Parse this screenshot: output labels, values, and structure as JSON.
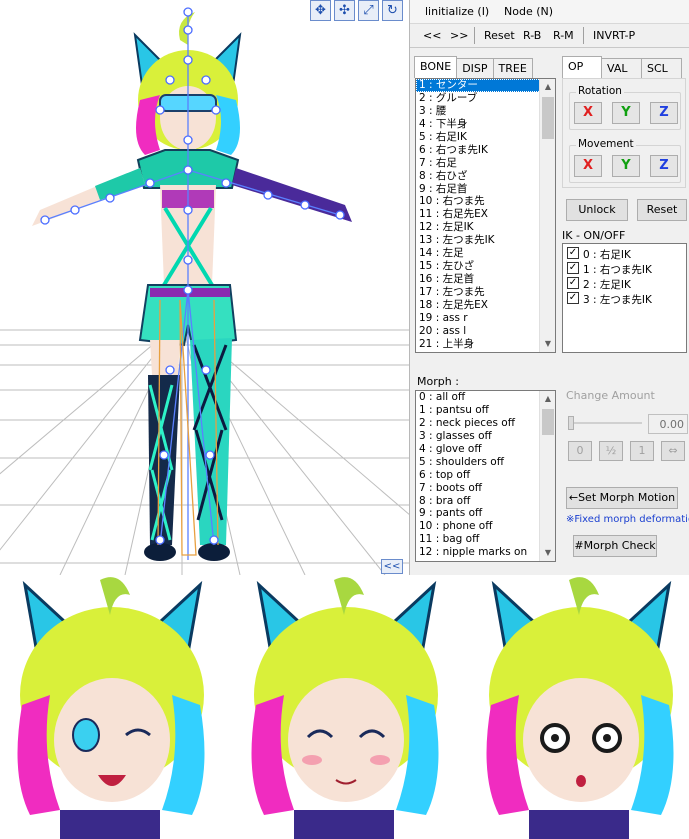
{
  "menu": {
    "initialize": "linitialize (I)",
    "node": "Node (N)"
  },
  "toolbar": {
    "prev": "<<",
    "next": ">>",
    "reset": "Reset",
    "rb": "R-B",
    "rm": "R-M",
    "invrt": "INVRT-P"
  },
  "bone_tabs": [
    "BONE",
    "DISP",
    "TREE"
  ],
  "op_tabs": [
    "OP",
    "VAL",
    "SCL"
  ],
  "bones": [
    "1 : センター",
    "2 : グルーブ",
    "3 : 腰",
    "4 : 下半身",
    "5 : 右足IK",
    "6 : 右つま先IK",
    "7 : 右足",
    "8 : 右ひざ",
    "9 : 右足首",
    "10 : 右つま先",
    "11 : 右足先EX",
    "12 : 左足IK",
    "13 : 左つま先IK",
    "14 : 左足",
    "15 : 左ひざ",
    "16 : 左足首",
    "17 : 左つま先",
    "18 : 左足先EX",
    "19 : ass r",
    "20 : ass l",
    "21 : 上半身"
  ],
  "rotation": {
    "title": "Rotation",
    "x": "X",
    "y": "Y",
    "z": "Z"
  },
  "movement": {
    "title": "Movement",
    "x": "X",
    "y": "Y",
    "z": "Z"
  },
  "unlock_label": "Unlock",
  "reset_label": "Reset",
  "ik": {
    "title": "IK - ON/OFF",
    "items": [
      "0 : 右足IK",
      "1 : 右つま先IK",
      "2 : 左足IK",
      "3 : 左つま先IK"
    ]
  },
  "morph": {
    "title": "Morph :",
    "items": [
      "0 : all off",
      "1 : pantsu off",
      "2 : neck pieces off",
      "3 : glasses off",
      "4 : glove off",
      "5 : shoulders off",
      "6 : top off",
      "7 : boots off",
      "8 : bra off",
      "9 : pants off",
      "10 : phone off",
      "11 : bag off",
      "12 : nipple marks on"
    ]
  },
  "change_amount": {
    "title": "Change Amount",
    "value": "0.00",
    "b0": "0",
    "bhalf": "½",
    "b1": "1",
    "bswap": "⇔"
  },
  "set_morph_label": "←Set Morph Motion",
  "fixed_note": "※Fixed morph deformation",
  "morph_check_label": "#Morph Check",
  "collapse": "<<",
  "colors": {
    "axis_x": "#e02020",
    "axis_y": "#10a010",
    "axis_z": "#2040e0",
    "selection": "#0078d7",
    "link": "#1a3fd0"
  }
}
